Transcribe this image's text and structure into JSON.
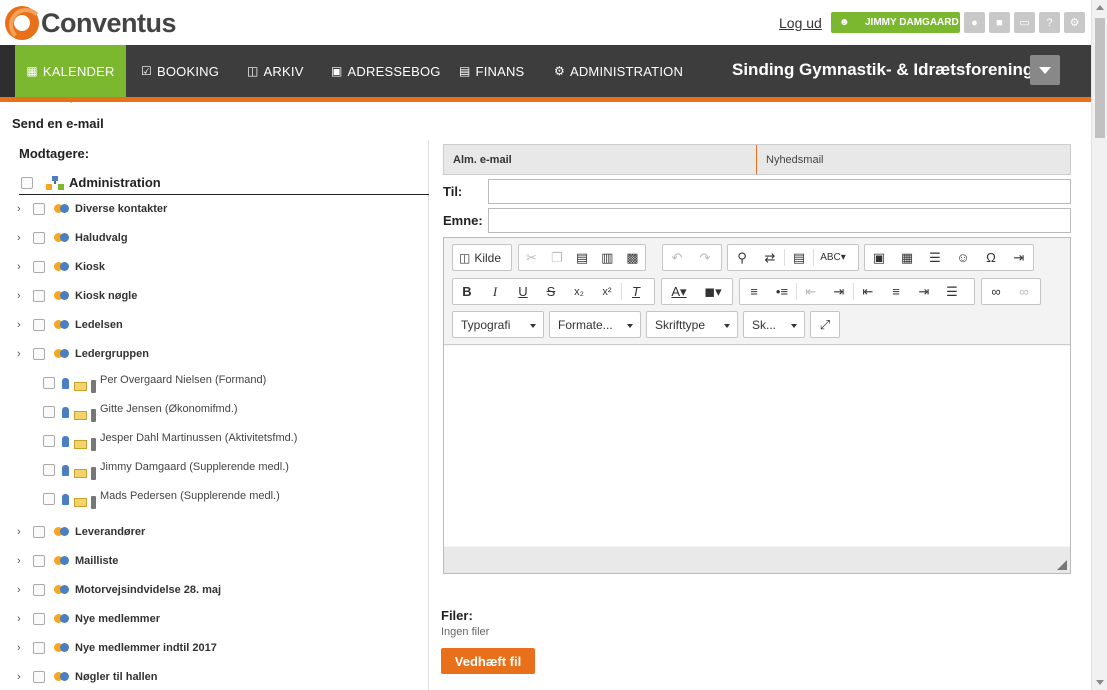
{
  "brand": {
    "name": "Conventus"
  },
  "header": {
    "logout": "Log ud",
    "user": "JIMMY DAMGAARD",
    "icons": [
      "chat-icon",
      "bank-icon",
      "monitor-icon",
      "help-icon",
      "settings-icon"
    ]
  },
  "nav": {
    "items": [
      {
        "label": "KALENDER",
        "icon": "calendar-icon",
        "active": true
      },
      {
        "label": "BOOKING",
        "icon": "booking-icon"
      },
      {
        "label": "ARKIV",
        "icon": "folder-icon"
      },
      {
        "label": "ADRESSEBOG",
        "icon": "addressbook-icon"
      },
      {
        "label": "FINANS",
        "icon": "bank-icon"
      },
      {
        "label": "ADMINISTRATION",
        "icon": "gear-icon"
      }
    ],
    "org": "Sinding Gymnastik- & Idrætsforening"
  },
  "page": {
    "title": "Send en e-mail"
  },
  "recipients": {
    "title": "Modtagere:",
    "root": "Administration",
    "groups_top": [
      "Diverse kontakter",
      "Haludvalg",
      "Kiosk",
      "Kiosk nøgle",
      "Ledelsen",
      "Ledergruppen"
    ],
    "members": [
      "Per Overgaard Nielsen (Formand)",
      "Gitte Jensen (Økonomifmd.)",
      "Jesper Dahl Martinussen (Aktivitetsfmd.)",
      "Jimmy Damgaard (Supplerende medl.)",
      "Mads Pedersen (Supplerende medl.)"
    ],
    "groups_bottom": [
      "Leverandører",
      "Mailliste",
      "Motorvejsindvidelse 28. maj",
      "Nye medlemmer",
      "Nye medlemmer indtil 2017",
      "Nøgler til hallen"
    ]
  },
  "mail": {
    "tabs": [
      "Alm. e-mail",
      "Nyhedsmail"
    ],
    "to_label": "Til:",
    "to_value": "",
    "subject_label": "Emne:",
    "subject_value": "",
    "source_button": "Kilde",
    "combos": [
      "Typografi",
      "Formate...",
      "Skrifttype",
      "Sk..."
    ]
  },
  "files": {
    "label": "Filer:",
    "none": "Ingen filer",
    "attach": "Vedhæft fil"
  },
  "colors": {
    "accent": "#e8701a",
    "green": "#7cb82f",
    "nav_bg": "#3d3d3d"
  }
}
